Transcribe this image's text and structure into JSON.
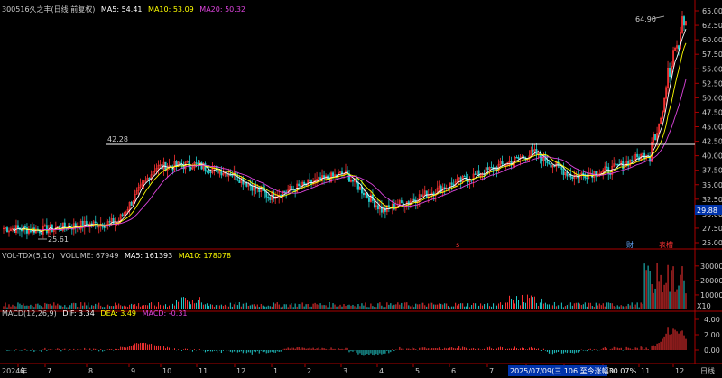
{
  "main": {
    "code": "300516",
    "name": "久之丰",
    "mode": "(日线 前复权)",
    "ma5": "MA5: 54.41",
    "ma10": "MA10: 53.09",
    "ma20": "MA20: 50.32",
    "high_label": "64.90",
    "low_label": "25.61",
    "level_label": "42.28",
    "current_price": "29.88",
    "marker_cai": "财",
    "marker_biao": "表槽",
    "marker_s": "s"
  },
  "volume": {
    "title": "VOL-TDX(5,10)",
    "volume": "VOLUME: 67949",
    "ma5": "MA5: 161393",
    "ma10": "MA10: 178078",
    "unit": "X10"
  },
  "macd": {
    "title": "MACD(12,26,9)",
    "dif": "DIF: 3.34",
    "dea": "DEA: 3.49",
    "macd": "MACD: -0.31"
  },
  "footer": {
    "year": "2024年",
    "status": "2025/07/09(三 106 至今涨幅30.07%",
    "period": "日线"
  },
  "price_axis": [
    "65.00",
    "62.50",
    "60.00",
    "57.50",
    "55.00",
    "52.50",
    "50.00",
    "47.50",
    "45.00",
    "42.50",
    "40.00",
    "37.50",
    "35.00",
    "32.50",
    "30.00",
    "27.50",
    "25.00"
  ],
  "vol_axis": [
    "30000",
    "20000",
    "10000"
  ],
  "macd_axis": [
    "4.00",
    "2.00",
    "0.00"
  ],
  "months": [
    "6",
    "7",
    "8",
    "9",
    "10",
    "11",
    "12",
    "1",
    "2",
    "3",
    "4",
    "5",
    "6",
    "7",
    "8",
    "9",
    "10",
    "11",
    "12"
  ],
  "colors": {
    "up": "#ff3333",
    "down": "#22cccc",
    "ma5": "#ffffff",
    "ma10": "#ffff00",
    "ma20": "#dd44dd",
    "bg": "#000000",
    "grid": "#7a0000"
  },
  "chart_data": {
    "type": "candlestick",
    "title": "300516 久之丰 (日线 前复权)",
    "price_range": [
      25.0,
      65.0
    ],
    "closes_by_month": [
      {
        "month": "2024-06",
        "close": 27.5
      },
      {
        "month": "2024-07",
        "close": 27.2
      },
      {
        "month": "2024-08",
        "close": 28.0
      },
      {
        "month": "2024-09",
        "close": 28.5
      },
      {
        "month": "2024-10",
        "close": 38.0
      },
      {
        "month": "2024-11",
        "close": 38.5
      },
      {
        "month": "2024-12",
        "close": 37.0
      },
      {
        "month": "2025-01",
        "close": 33.0
      },
      {
        "month": "2025-02",
        "close": 35.0
      },
      {
        "month": "2025-03",
        "close": 37.0
      },
      {
        "month": "2025-04",
        "close": 30.5
      },
      {
        "month": "2025-05",
        "close": 33.0
      },
      {
        "month": "2025-06",
        "close": 35.5
      },
      {
        "month": "2025-07",
        "close": 38.0
      },
      {
        "month": "2025-08",
        "close": 40.5
      },
      {
        "month": "2025-09",
        "close": 36.5
      },
      {
        "month": "2025-10",
        "close": 37.5
      },
      {
        "month": "2025-11",
        "close": 40.5
      },
      {
        "month": "2025-12",
        "close": 54.4
      }
    ],
    "high": 64.9,
    "low": 25.61,
    "horizontal_level": 42.28
  }
}
